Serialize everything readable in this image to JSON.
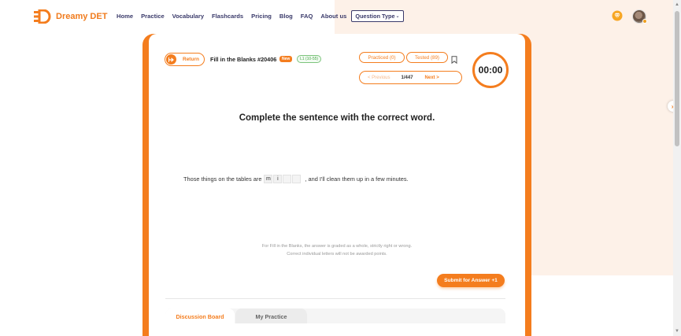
{
  "nav": {
    "brand": "Dreamy DET",
    "links": [
      "Home",
      "Practice",
      "Vocabulary",
      "Flashcards",
      "Pricing",
      "Blog",
      "FAQ",
      "About us"
    ],
    "question_type": "Question Type",
    "question_type_caret": "⌄"
  },
  "header": {
    "return_label": "Return",
    "question_title": "Fill in the Blanks #20406",
    "new_badge": "New",
    "level_badge": "L1 (10-55)",
    "practiced": "Practiced (0)",
    "tested": "Tested (89)",
    "prev": "< Previous",
    "position": "1/447",
    "next": "Next >",
    "timer": "00:00"
  },
  "question": {
    "instruction": "Complete the sentence with the correct word.",
    "before": "Those things on the tables are",
    "letters": [
      "m",
      "i",
      "",
      ""
    ],
    "after": ", and I'll clean them up in a few minutes.",
    "note_line1": "For Fill in the Blanks, the answer is graded as a whole, strictly right or wrong.",
    "note_line2": "Correct individual letters will not be awarded points."
  },
  "actions": {
    "submit_label": "Submit for Answer +1"
  },
  "tabs": [
    "Discussion Board",
    "My Practice"
  ],
  "colors": {
    "accent": "#f47d1e",
    "nav_text": "#3a3a6a",
    "background_blob": "#fdf1e8"
  }
}
